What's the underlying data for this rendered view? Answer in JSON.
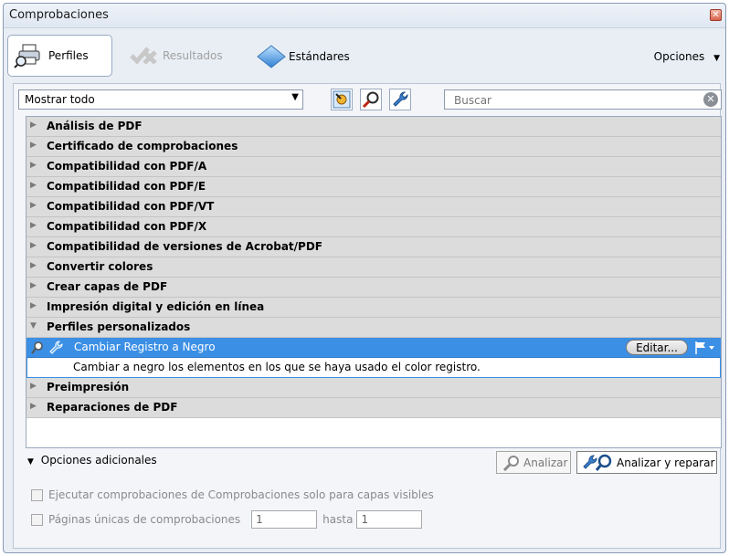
{
  "window": {
    "title": "Comprobaciones"
  },
  "tabs": [
    {
      "label": "Perfiles"
    },
    {
      "label": "Resultados"
    },
    {
      "label": "Estándares"
    }
  ],
  "options_menu": {
    "label": "Opciones"
  },
  "filter": {
    "selected": "Mostrar todo"
  },
  "search": {
    "placeholder": "Buscar"
  },
  "list": {
    "categories_top": [
      "Análisis de PDF",
      "Certificado de comprobaciones",
      "Compatibilidad con PDF/A",
      "Compatibilidad con PDF/E",
      "Compatibilidad con PDF/VT",
      "Compatibilidad con PDF/X",
      "Compatibilidad de versiones de Acrobat/PDF",
      "Convertir colores",
      "Crear capas de PDF",
      "Impresión digital y edición en línea",
      "Perfiles personalizados"
    ],
    "selected_profile": {
      "name": "Cambiar Registro a Negro",
      "edit_label": "Editar...",
      "description": "Cambiar a negro los elementos en los que se haya usado el color registro."
    },
    "categories_bottom": [
      "Preimpresión",
      "Reparaciones de PDF"
    ]
  },
  "additional": {
    "label": "Opciones adicionales",
    "analyze_label": "Analizar",
    "analyze_fix_label": "Analizar y reparar",
    "visible_layers_label": "Ejecutar comprobaciones de Comprobaciones solo para capas visibles",
    "pages_label": "Páginas únicas de comprobaciones",
    "pages_from": "1",
    "to_label": "hasta",
    "pages_to": "1"
  }
}
